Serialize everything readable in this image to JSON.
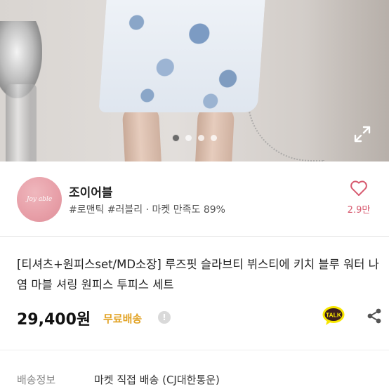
{
  "gallery": {
    "page_count": 4,
    "active_index": 1
  },
  "seller": {
    "logo_text": "Joy able",
    "name": "조이어블",
    "meta": "#로맨틱 #러블리 · 마켓 만족도 89%",
    "like_count": "2.9만"
  },
  "product": {
    "title": "[티셔츠+원피스set/MD소장] 루즈핏 슬라브티 뷔스티에 키치 블루 워터 나염 마블 셔링 원피스 투피스 세트",
    "price": "29,400원",
    "shipping_badge": "무료배송",
    "info_symbol": "!",
    "talk_label": "TALK"
  },
  "shipping": {
    "label": "배송정보",
    "value": "마켓 직접 배송 (CJ대한통운)"
  },
  "colors": {
    "accent_like": "#d75a6f",
    "free_shipping": "#e2a325",
    "kakao_yellow": "#f7e600"
  }
}
